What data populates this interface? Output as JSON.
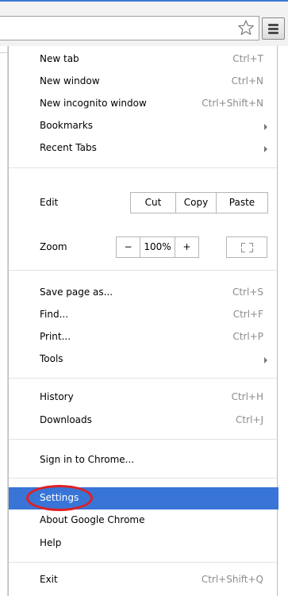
{
  "accent_color": "#3875d7",
  "toolbar": {
    "bookmark_icon": "star-outline-icon",
    "menu_icon": "hamburger-menu-icon"
  },
  "menu": {
    "new_tab": {
      "label": "New tab",
      "shortcut": "Ctrl+T"
    },
    "new_window": {
      "label": "New window",
      "shortcut": "Ctrl+N"
    },
    "incognito": {
      "label": "New incognito window",
      "shortcut": "Ctrl+Shift+N"
    },
    "bookmarks": {
      "label": "Bookmarks"
    },
    "recent_tabs": {
      "label": "Recent Tabs"
    },
    "edit": {
      "label": "Edit",
      "cut": "Cut",
      "copy": "Copy",
      "paste": "Paste"
    },
    "zoom": {
      "label": "Zoom",
      "minus": "−",
      "value": "100%",
      "plus": "+"
    },
    "save_page": {
      "label": "Save page as...",
      "shortcut": "Ctrl+S"
    },
    "find": {
      "label": "Find...",
      "shortcut": "Ctrl+F"
    },
    "print": {
      "label": "Print...",
      "shortcut": "Ctrl+P"
    },
    "tools": {
      "label": "Tools"
    },
    "history": {
      "label": "History",
      "shortcut": "Ctrl+H"
    },
    "downloads": {
      "label": "Downloads",
      "shortcut": "Ctrl+J"
    },
    "sign_in": {
      "label": "Sign in to Chrome..."
    },
    "settings": {
      "label": "Settings"
    },
    "about": {
      "label": "About Google Chrome"
    },
    "help": {
      "label": "Help"
    },
    "exit": {
      "label": "Exit",
      "shortcut": "Ctrl+Shift+Q"
    }
  }
}
